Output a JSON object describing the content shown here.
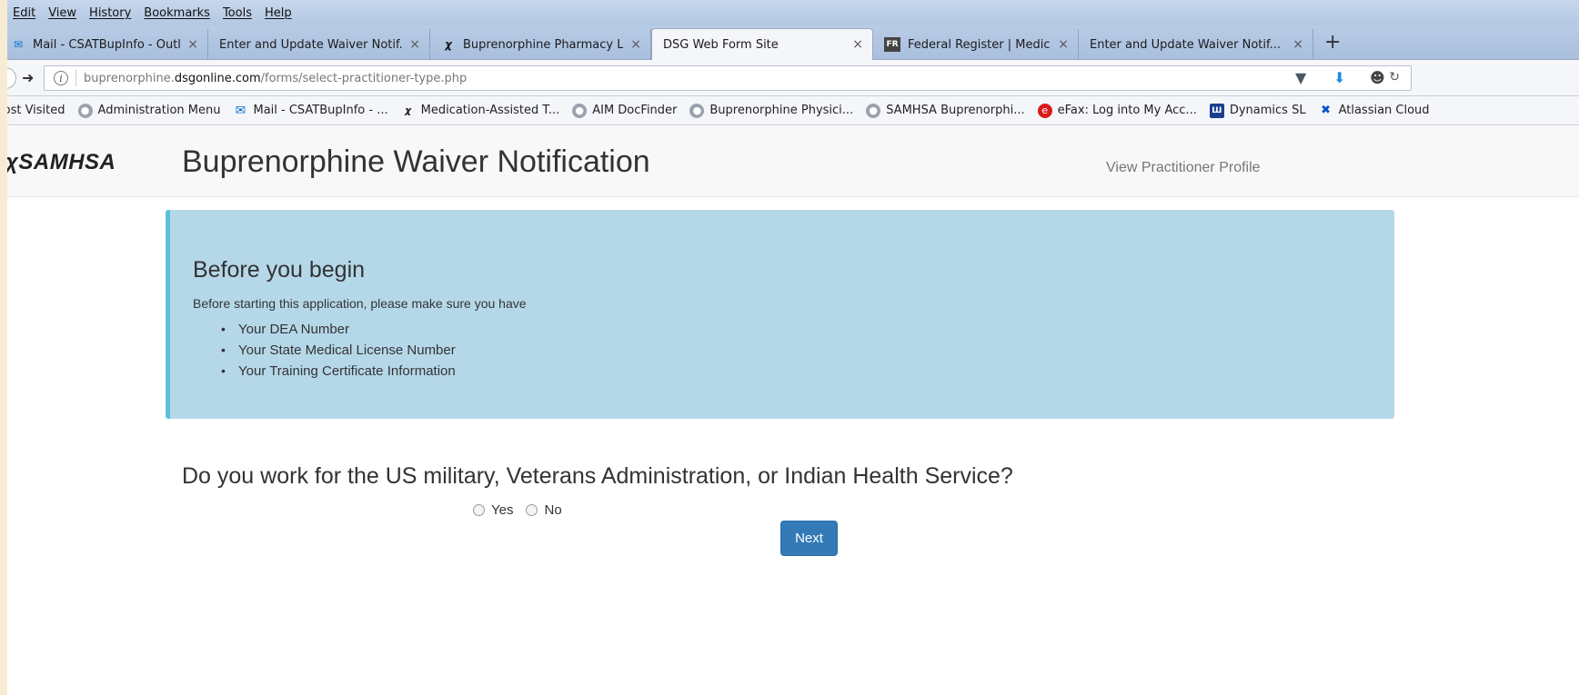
{
  "menu": [
    "Edit",
    "View",
    "History",
    "Bookmarks",
    "Tools",
    "Help"
  ],
  "tabs": [
    {
      "label": "Mail - CSATBupInfo - Outl...",
      "icon": "mail-icon",
      "active": false
    },
    {
      "label": "Enter and Update Waiver Notif...",
      "icon": "",
      "active": false
    },
    {
      "label": "Buprenorphine Pharmacy L...",
      "icon": "samhsa-figure-icon",
      "active": false
    },
    {
      "label": "DSG Web Form Site",
      "icon": "",
      "active": true
    },
    {
      "label": "Federal Register | Medicati...",
      "icon": "fr-icon",
      "active": false
    },
    {
      "label": "Enter and Update Waiver Notif...",
      "icon": "",
      "active": false
    }
  ],
  "tab_close": "×",
  "new_tab": "+",
  "address": {
    "prefix": "buprenorphine.",
    "domain": "dsgonline.com",
    "path": "/forms/select-practitioner-type.php"
  },
  "bookmarks": [
    {
      "label": "lost Visited",
      "icon": ""
    },
    {
      "label": "Administration Menu",
      "icon": "globe-icon"
    },
    {
      "label": "Mail - CSATBupInfo - ...",
      "icon": "mail-icon"
    },
    {
      "label": "Medication-Assisted T...",
      "icon": "samhsa-figure-icon"
    },
    {
      "label": "AIM DocFinder",
      "icon": "globe-icon"
    },
    {
      "label": "Buprenorphine Physici...",
      "icon": "globe-icon"
    },
    {
      "label": "SAMHSA Buprenorphi...",
      "icon": "globe-icon"
    },
    {
      "label": "eFax: Log into My Acc...",
      "icon": "efax-icon"
    },
    {
      "label": "Dynamics SL",
      "icon": "dynamics-icon"
    },
    {
      "label": "Atlassian Cloud",
      "icon": "atlassian-icon"
    }
  ],
  "site": {
    "logo": "SAMHSA",
    "title": "Buprenorphine Waiver Notification",
    "profile_link": "View Practitioner Profile"
  },
  "callout": {
    "title": "Before you begin",
    "intro": "Before starting this application, please make sure you have",
    "items": [
      "Your DEA Number",
      "Your State Medical License Number",
      "Your Training Certificate Information"
    ]
  },
  "form": {
    "question": "Do you work for the US military, Veterans Administration, or Indian Health Service?",
    "option_yes": "Yes",
    "option_no": "No",
    "next_label": "Next"
  },
  "colors": {
    "callout_bg": "#b5d8e9",
    "callout_border": "#5bc0de",
    "button_primary": "#337ab7"
  }
}
